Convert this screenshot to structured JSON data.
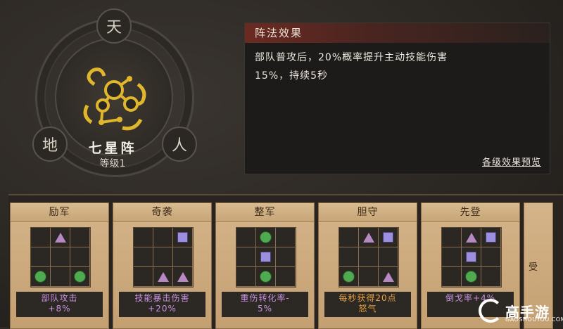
{
  "formation": {
    "seal_top": "天",
    "seal_left": "地",
    "seal_right": "人",
    "name": "七星阵",
    "level": "等级1"
  },
  "effect": {
    "header": "阵法效果",
    "line1": "部队普攻后，20%概率提升主动技能伤害",
    "line2": "15%，持续5秒",
    "preview_link": "各级效果预览"
  },
  "cards": [
    {
      "title": "励军",
      "effect_line1": "部队攻击",
      "effect_line2": "+8%",
      "effect_color": "purple",
      "grid": [
        "",
        "triangle",
        "",
        "",
        "",
        "",
        "circle",
        "",
        "circle"
      ]
    },
    {
      "title": "奇袭",
      "effect_line1": "技能暴击伤害",
      "effect_line2": "+20%",
      "effect_color": "purple",
      "grid": [
        "",
        "",
        "square",
        "",
        "",
        "",
        "",
        "triangle",
        "triangle"
      ]
    },
    {
      "title": "整军",
      "effect_line1": "重伤转化率-",
      "effect_line2": "5%",
      "effect_color": "purple",
      "grid": [
        "",
        "circle",
        "",
        "",
        "square",
        "",
        "",
        "circle",
        ""
      ]
    },
    {
      "title": "胆守",
      "effect_line1": "每秒获得20点",
      "effect_line2": "怒气",
      "effect_color": "orange",
      "grid": [
        "",
        "triangle",
        "square",
        "",
        "",
        "",
        "circle",
        "",
        "triangle"
      ]
    },
    {
      "title": "先登",
      "effect_line1": "倒戈率+4%",
      "effect_line2": "",
      "effect_color": "purple",
      "grid": [
        "",
        "triangle",
        "square",
        "",
        "square",
        "",
        "",
        "circle",
        ""
      ]
    }
  ],
  "partial_card": {
    "label": "受"
  },
  "brand": {
    "name": "高手游",
    "sub": "GAOSHOUYOU.COM"
  }
}
